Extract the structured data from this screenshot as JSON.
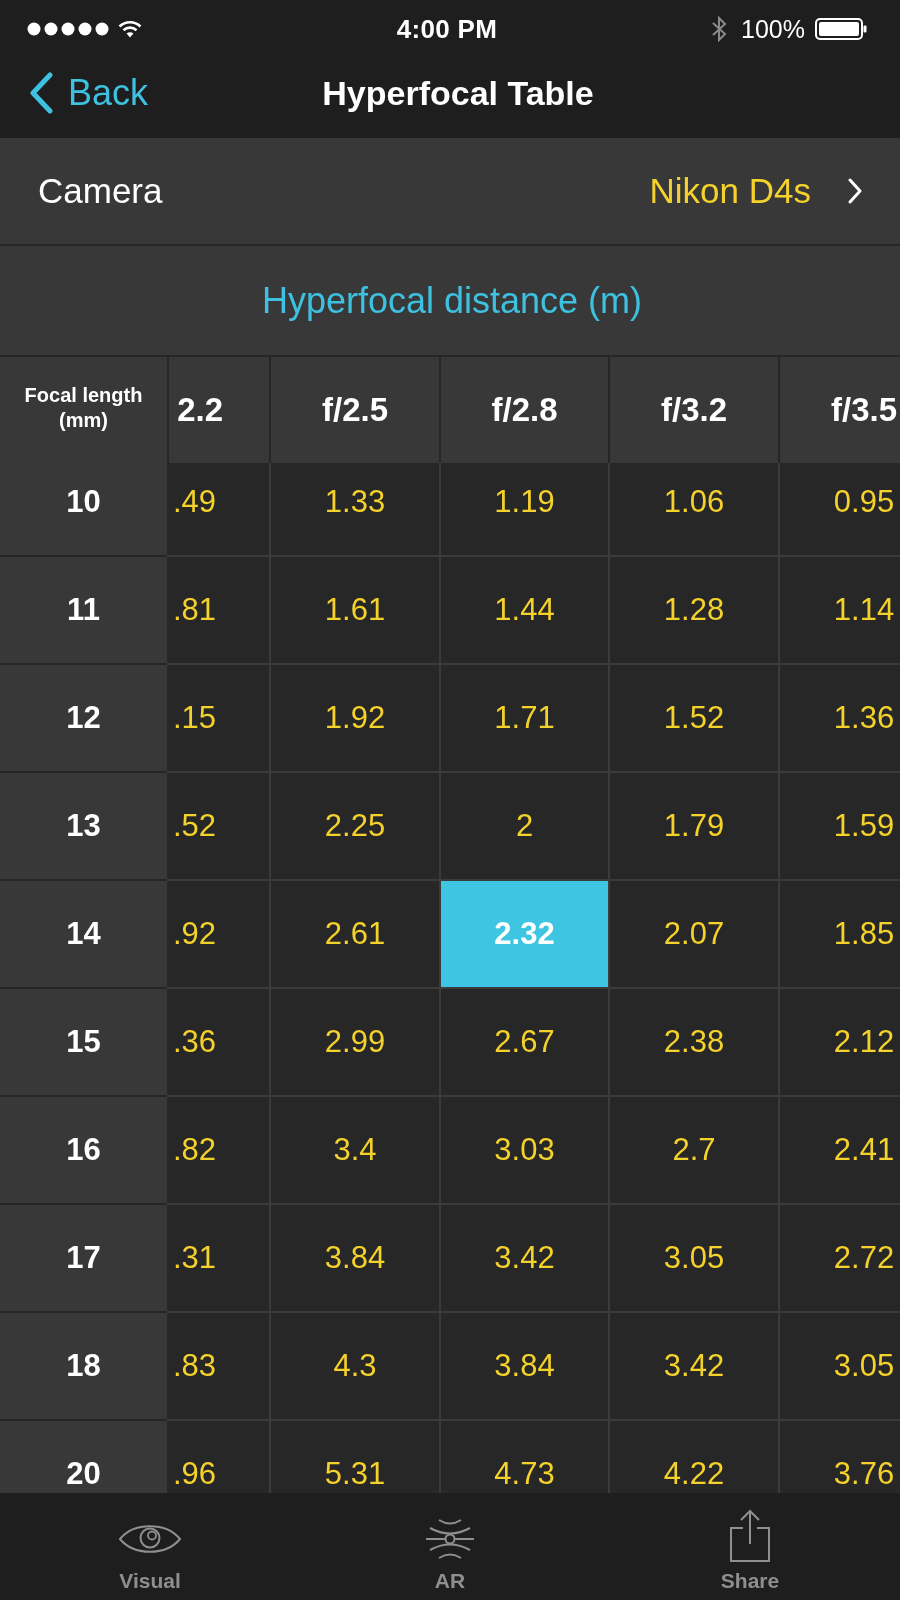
{
  "status_bar": {
    "time": "4:00 PM",
    "battery_percent": "100%"
  },
  "nav_bar": {
    "back_label": "Back",
    "title": "Hyperfocal Table"
  },
  "camera": {
    "label": "Camera",
    "value": "Nikon D4s"
  },
  "table": {
    "title": "Hyperfocal distance (m)",
    "corner_header": "Focal length (mm)",
    "columns": [
      "2.2",
      "f/2.5",
      "f/2.8",
      "f/3.2",
      "f/3.5"
    ],
    "rows": [
      {
        "focal_length": "10",
        "cells": [
          {
            "value": ".49",
            "selected": false
          },
          {
            "value": "1.33",
            "selected": false
          },
          {
            "value": "1.19",
            "selected": false
          },
          {
            "value": "1.06",
            "selected": false
          },
          {
            "value": "0.95",
            "selected": false
          }
        ]
      },
      {
        "focal_length": "11",
        "cells": [
          {
            "value": ".81",
            "selected": false
          },
          {
            "value": "1.61",
            "selected": false
          },
          {
            "value": "1.44",
            "selected": false
          },
          {
            "value": "1.28",
            "selected": false
          },
          {
            "value": "1.14",
            "selected": false
          }
        ]
      },
      {
        "focal_length": "12",
        "cells": [
          {
            "value": ".15",
            "selected": false
          },
          {
            "value": "1.92",
            "selected": false
          },
          {
            "value": "1.71",
            "selected": false
          },
          {
            "value": "1.52",
            "selected": false
          },
          {
            "value": "1.36",
            "selected": false
          }
        ]
      },
      {
        "focal_length": "13",
        "cells": [
          {
            "value": ".52",
            "selected": false
          },
          {
            "value": "2.25",
            "selected": false
          },
          {
            "value": "2",
            "selected": false
          },
          {
            "value": "1.79",
            "selected": false
          },
          {
            "value": "1.59",
            "selected": false
          }
        ]
      },
      {
        "focal_length": "14",
        "cells": [
          {
            "value": ".92",
            "selected": false
          },
          {
            "value": "2.61",
            "selected": false
          },
          {
            "value": "2.32",
            "selected": true
          },
          {
            "value": "2.07",
            "selected": false
          },
          {
            "value": "1.85",
            "selected": false
          }
        ]
      },
      {
        "focal_length": "15",
        "cells": [
          {
            "value": ".36",
            "selected": false
          },
          {
            "value": "2.99",
            "selected": false
          },
          {
            "value": "2.67",
            "selected": false
          },
          {
            "value": "2.38",
            "selected": false
          },
          {
            "value": "2.12",
            "selected": false
          }
        ]
      },
      {
        "focal_length": "16",
        "cells": [
          {
            "value": ".82",
            "selected": false
          },
          {
            "value": "3.4",
            "selected": false
          },
          {
            "value": "3.03",
            "selected": false
          },
          {
            "value": "2.7",
            "selected": false
          },
          {
            "value": "2.41",
            "selected": false
          }
        ]
      },
      {
        "focal_length": "17",
        "cells": [
          {
            "value": ".31",
            "selected": false
          },
          {
            "value": "3.84",
            "selected": false
          },
          {
            "value": "3.42",
            "selected": false
          },
          {
            "value": "3.05",
            "selected": false
          },
          {
            "value": "2.72",
            "selected": false
          }
        ]
      },
      {
        "focal_length": "18",
        "cells": [
          {
            "value": ".83",
            "selected": false
          },
          {
            "value": "4.3",
            "selected": false
          },
          {
            "value": "3.84",
            "selected": false
          },
          {
            "value": "3.42",
            "selected": false
          },
          {
            "value": "3.05",
            "selected": false
          }
        ]
      },
      {
        "focal_length": "20",
        "cells": [
          {
            "value": ".96",
            "selected": false
          },
          {
            "value": "5.31",
            "selected": false
          },
          {
            "value": "4.73",
            "selected": false
          },
          {
            "value": "4.22",
            "selected": false
          },
          {
            "value": "3.76",
            "selected": false
          }
        ]
      }
    ]
  },
  "tab_bar": [
    {
      "kind": "visual",
      "label": "Visual"
    },
    {
      "kind": "ar",
      "label": "AR"
    },
    {
      "kind": "share",
      "label": "Share"
    }
  ]
}
